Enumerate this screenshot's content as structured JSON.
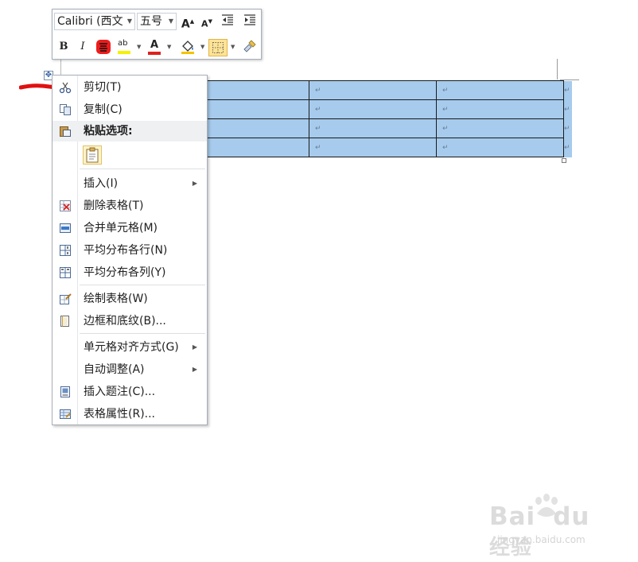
{
  "toolbar": {
    "font_name": "Calibri (西文",
    "font_size": "五号",
    "grow_font_glyph": "A",
    "shrink_font_glyph": "A",
    "bold_glyph": "B",
    "italic_glyph": "I",
    "font_color_glyph": "A",
    "highlight_glyph": "ab",
    "font_color": "#e02020",
    "highlight_color": "#f5f200"
  },
  "table": {
    "cell_mark": "↵",
    "rows": 4,
    "cell_color": "#a6cbed"
  },
  "context_menu": {
    "items": [
      {
        "label": "剪切(T)",
        "icon": "scissors-icon"
      },
      {
        "label": "复制(C)",
        "icon": "copy-icon"
      },
      {
        "label": "粘贴选项:",
        "icon": "paste-icon"
      },
      {
        "label": "插入(I)",
        "icon": "",
        "submenu": true
      },
      {
        "label": "删除表格(T)",
        "icon": "delete-table-icon"
      },
      {
        "label": "合并单元格(M)",
        "icon": "merge-cells-icon"
      },
      {
        "label": "平均分布各行(N)",
        "icon": "distribute-rows-icon"
      },
      {
        "label": "平均分布各列(Y)",
        "icon": "distribute-columns-icon"
      },
      {
        "label": "绘制表格(W)",
        "icon": "draw-table-icon"
      },
      {
        "label": "边框和底纹(B)...",
        "icon": "borders-shading-icon"
      },
      {
        "label": "单元格对齐方式(G)",
        "icon": "",
        "submenu": true
      },
      {
        "label": "自动调整(A)",
        "icon": "",
        "submenu": true
      },
      {
        "label": "插入题注(C)...",
        "icon": "insert-caption-icon"
      },
      {
        "label": "表格属性(R)...",
        "icon": "table-properties-icon"
      }
    ],
    "submenu_arrow": "▶"
  },
  "watermark": {
    "brand": "Bai",
    "brand_suffix": "du",
    "brand_cn": "经验",
    "url": "jingyan.baidu.com"
  }
}
